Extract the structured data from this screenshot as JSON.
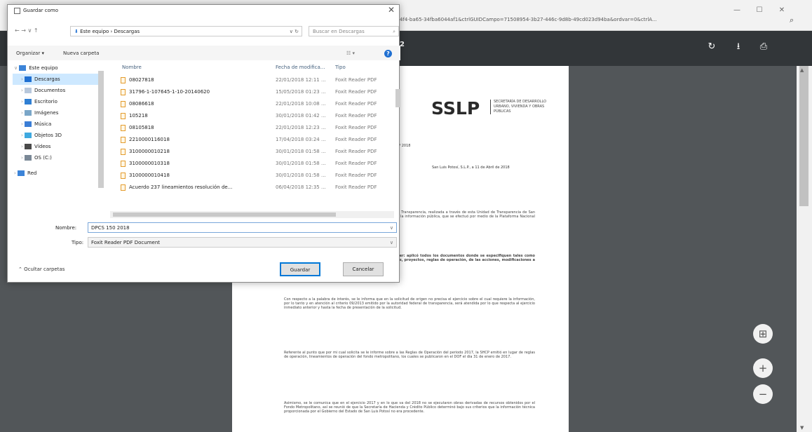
{
  "browser": {
    "url": "4f4-ba65-34fba6044af1&ctrlGUIDCampo=71508954-3b27-446c-9d8b-49cd023d94ba&ordvar=0&ctrlA...",
    "minimize": "—",
    "maximize": "☐",
    "close": "✕"
  },
  "pdf": {
    "title": "2",
    "rotate": "↻",
    "download": "⭳",
    "print": "⎙"
  },
  "doc": {
    "logo": "SSLP",
    "logo_sub": "SECRETARÍA DE DESARROLLO URBANO, VIVIENDA Y OBRAS PÚBLICAS",
    "ref": "SEDUVOP\n2018",
    "date": "San Luis Potosí, S.L.P., a 11 de Abril de 2018",
    "paras": [
      "del día 22 de marzo de la presente anualidad, por la Unidad de Transparencia, realizada a través de esta Unidad de Transparencia de San Luis, contenida en el acuse de recibo de la solicitud de acceso a la información pública, que se efectuó por medio de la Plataforma Nacional de Transparencia del 2018. En tal tenor, expongo lo siguiente:",
      "en los que señala su requerimiento en el sentido de saber: aplicó todos los documentos donde se especifiquen tales como contratos, convenios, acuerdos, transferencias, programas, proyectos, reglas de operación, de las acciones, modificaciones a los proyectos, autorizaciones de la aplicación de fondos.",
      "Con respecto a la palabra de interés, se le informa que en la solicitud de origen no precisa el ejercicio sobre el cual requiere la información, por lo tanto y en atención al criterio 09/2013 emitido por la autoridad federal de transparencia, será atendida por lo que respecta al ejercicio inmediato anterior y hasta la fecha de presentación de la solicitud.",
      "Referente al punto que por mi cual solicita se le informe sobre a las Reglas de Operación del periodo 2017, la SHCP emitió en lugar de reglas de operación, lineamientos de operación del fondo metropolitano, los cuales se publicaron en el DOF el día 31 de enero de 2017.",
      "Asimismo, se le comunica que en el ejercicio 2017 y en lo que va del 2018 no se ejecutaron obras derivadas de recursos obtenidos por el Fondo Metropolitano, así se reunió de que la Secretaría de Hacienda y Crédito Público determinó bajo sus criterios que la información técnica proporcionada por el Gobierno del Estado de San Luis Potosí no era procedente."
    ]
  },
  "fab": {
    "fit": "⊞",
    "zoom_in": "+",
    "zoom_out": "−"
  },
  "dialog": {
    "title": "Guardar como",
    "close": "✕",
    "address": "Este equipo  ›  Descargas",
    "search_placeholder": "Buscar en Descargas",
    "organize": "Organizar ▾",
    "new_folder": "Nueva carpeta",
    "help": "?",
    "tree": [
      {
        "label": "Este equipo",
        "icon": "computer-icon",
        "level": 0
      },
      {
        "label": "Descargas",
        "icon": "downloads-icon",
        "level": 1
      },
      {
        "label": "Documentos",
        "icon": "documents-icon",
        "level": 1
      },
      {
        "label": "Escritorio",
        "icon": "desktop-icon",
        "level": 1
      },
      {
        "label": "Imágenes",
        "icon": "images-icon",
        "level": 1
      },
      {
        "label": "Música",
        "icon": "music-icon",
        "level": 1
      },
      {
        "label": "Objetos 3D",
        "icon": "objects3d-icon",
        "level": 1
      },
      {
        "label": "Vídeos",
        "icon": "videos-icon",
        "level": 1
      },
      {
        "label": "OS (C:)",
        "icon": "drive-icon",
        "level": 1
      },
      {
        "label": "Red",
        "icon": "network-icon",
        "level": 0
      }
    ],
    "headers": [
      "Nombre",
      "Fecha de modifica...",
      "Tipo"
    ],
    "files": [
      {
        "name": "08027818",
        "date": "22/01/2018 12:11 ...",
        "type": "Foxit Reader PDF"
      },
      {
        "name": "31796-1-107645-1-10-20140620",
        "date": "15/05/2018 01:23 ...",
        "type": "Foxit Reader PDF"
      },
      {
        "name": "08086618",
        "date": "22/01/2018 10:08 ...",
        "type": "Foxit Reader PDF"
      },
      {
        "name": "105218",
        "date": "30/01/2018 01:42 ...",
        "type": "Foxit Reader PDF"
      },
      {
        "name": "08105818",
        "date": "22/01/2018 12:23 ...",
        "type": "Foxit Reader PDF"
      },
      {
        "name": "2210000116018",
        "date": "17/04/2018 03:24 ...",
        "type": "Foxit Reader PDF"
      },
      {
        "name": "3100000010218",
        "date": "30/01/2018 01:58 ...",
        "type": "Foxit Reader PDF"
      },
      {
        "name": "3100000010318",
        "date": "30/01/2018 01:58 ...",
        "type": "Foxit Reader PDF"
      },
      {
        "name": "3100000010418",
        "date": "30/01/2018 01:58 ...",
        "type": "Foxit Reader PDF"
      },
      {
        "name": "Acuerdo 237 lineamientos resolución de...",
        "date": "06/04/2018 12:35 ...",
        "type": "Foxit Reader PDF"
      }
    ],
    "filename_label": "Nombre:",
    "filename_value": "DPCS 150 2018",
    "type_label": "Tipo:",
    "type_value": "Foxit Reader PDF Document",
    "hide_folders": "Ocultar carpetas",
    "save": "Guardar",
    "cancel": "Cancelar"
  }
}
